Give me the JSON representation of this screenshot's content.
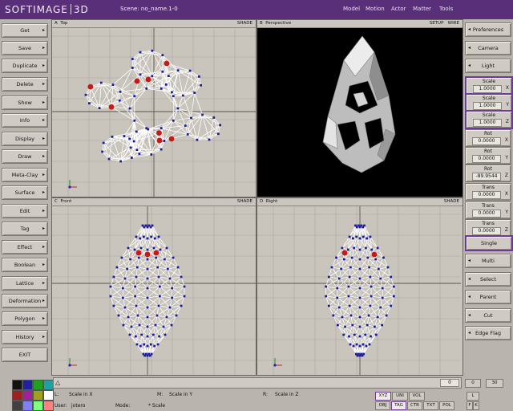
{
  "app": {
    "logo_left": "SOFTIMAGE",
    "logo_right": "3D",
    "scene": "Scene: no_name.1-0"
  },
  "modules": [
    "Model",
    "Motion",
    "Actor",
    "Matter",
    "Tools"
  ],
  "left_menu": [
    "Get",
    "Save",
    "Duplicate",
    "Delete",
    "Show",
    "Info",
    "Display",
    "Draw",
    "Meta-Clay",
    "Surface",
    "Edit",
    "Tag",
    "Effect",
    "Boolean",
    "Lattice",
    "Deformation",
    "Polygon",
    "History",
    "EXIT"
  ],
  "right_panel": {
    "preferences": "Preferences",
    "camera": "Camera",
    "light": "Light",
    "fields": [
      {
        "label": "Scale",
        "value": "1.0000",
        "axis": "X",
        "selected": true
      },
      {
        "label": "Scale",
        "value": "1.0000",
        "axis": "Y",
        "selected": true
      },
      {
        "label": "Scale",
        "value": "1.0000",
        "axis": "Z",
        "selected": true
      },
      {
        "label": "Rot",
        "value": "0.0000",
        "axis": "X",
        "selected": false
      },
      {
        "label": "Rot",
        "value": "0.0000",
        "axis": "Y",
        "selected": false
      },
      {
        "label": "Rot",
        "value": "-89.9544",
        "axis": "Z",
        "selected": false
      },
      {
        "label": "Trans",
        "value": "0.0000",
        "axis": "X",
        "selected": false
      },
      {
        "label": "Trans",
        "value": "0.0000",
        "axis": "Y",
        "selected": false
      },
      {
        "label": "Trans",
        "value": "0.0000",
        "axis": "Z",
        "selected": false
      }
    ],
    "single": "Single",
    "multi": "Multi",
    "select": "Select",
    "parent": "Parent",
    "cut": "Cut",
    "edge_flag": "Edge Flag"
  },
  "viewports": {
    "top": {
      "letter": "A",
      "name": "Top",
      "mode": "SHADE"
    },
    "perspective": {
      "letter": "B",
      "name": "Perspective",
      "setup": "SETUP",
      "mode": "WIRE"
    },
    "front": {
      "letter": "C",
      "name": "Front",
      "mode": "SHADE"
    },
    "right": {
      "letter": "D",
      "name": "Right",
      "mode": "SHADE"
    }
  },
  "status": {
    "frame": "0",
    "l_label": "L:",
    "l_value": "Scale in X",
    "m_label": "M:",
    "m_value": "Scale in Y",
    "r_label": "R:",
    "r_value": "Scale in Z",
    "user_label": "User:",
    "user_value": "jotero",
    "mode_label": "Mode:",
    "mode_value": "* Scale",
    "buttons_row1": [
      "XYZ",
      "UNI",
      "VOL"
    ],
    "buttons_row2": [
      "OBJ",
      "TAG",
      "CTR",
      "TXT",
      "POL"
    ],
    "spin_left": "0",
    "spin_right": "30",
    "small_btns": [
      "L",
      "F",
      "K"
    ]
  },
  "colors": {
    "menubar": "#5a2f7a",
    "selected_outline": "#6c3c95",
    "vertex": "#1a1a9a",
    "tagged": "#c81818",
    "viewport_bg": "#c9c5bd",
    "perspective_bg": "#000000"
  },
  "palette": [
    "#111111",
    "#2020a0",
    "#20a020",
    "#20a0a0",
    "#a02020",
    "#a020a0",
    "#a0a020",
    "#ffffff",
    "#404040",
    "#8080ff",
    "#80ff80",
    "#ff8080"
  ]
}
